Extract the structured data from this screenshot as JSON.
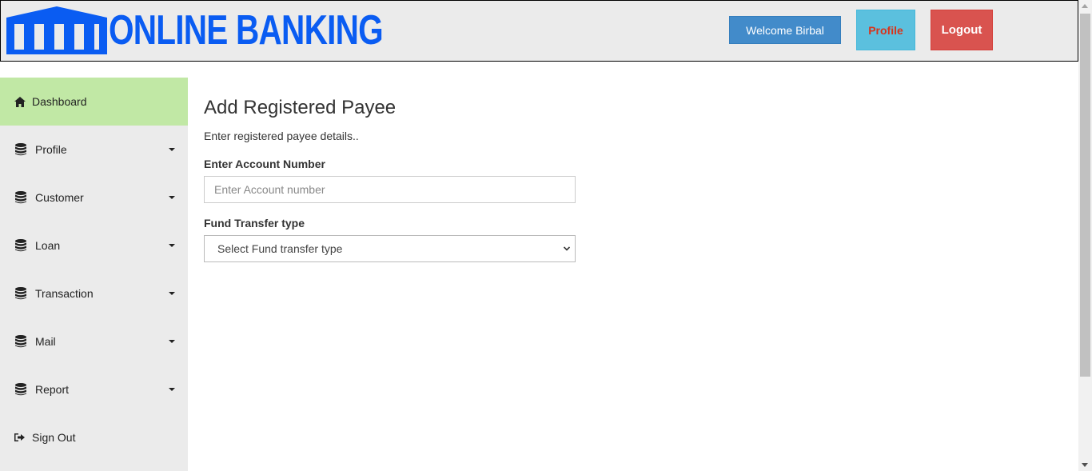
{
  "header": {
    "logo_text": "ONLINE BANKING",
    "welcome_label": "Welcome Birbal",
    "profile_label": "Profile",
    "logout_label": "Logout"
  },
  "sidebar": {
    "items": [
      {
        "label": "Dashboard",
        "icon": "home-icon",
        "active": true
      },
      {
        "label": "Profile",
        "icon": "database-icon"
      },
      {
        "label": "Customer",
        "icon": "database-icon"
      },
      {
        "label": "Loan",
        "icon": "database-icon"
      },
      {
        "label": "Transaction",
        "icon": "database-icon"
      },
      {
        "label": "Mail",
        "icon": "database-icon"
      },
      {
        "label": "Report",
        "icon": "database-icon"
      },
      {
        "label": "Sign Out",
        "icon": "sign-out-icon"
      }
    ]
  },
  "main": {
    "title": "Add Registered Payee",
    "subtitle": "Enter registered payee details..",
    "account_label": "Enter Account Number",
    "account_placeholder": "Enter Account number",
    "account_value": "",
    "fund_label": "Fund Transfer type",
    "fund_selected": "Select Fund transfer type"
  },
  "colors": {
    "header_bg": "#ebebeb",
    "logo_blue": "#0a5cf2",
    "active_nav": "#c1e8a5",
    "welcome_btn": "#428bca",
    "profile_btn": "#5bc0de",
    "logout_btn": "#d9534f"
  }
}
